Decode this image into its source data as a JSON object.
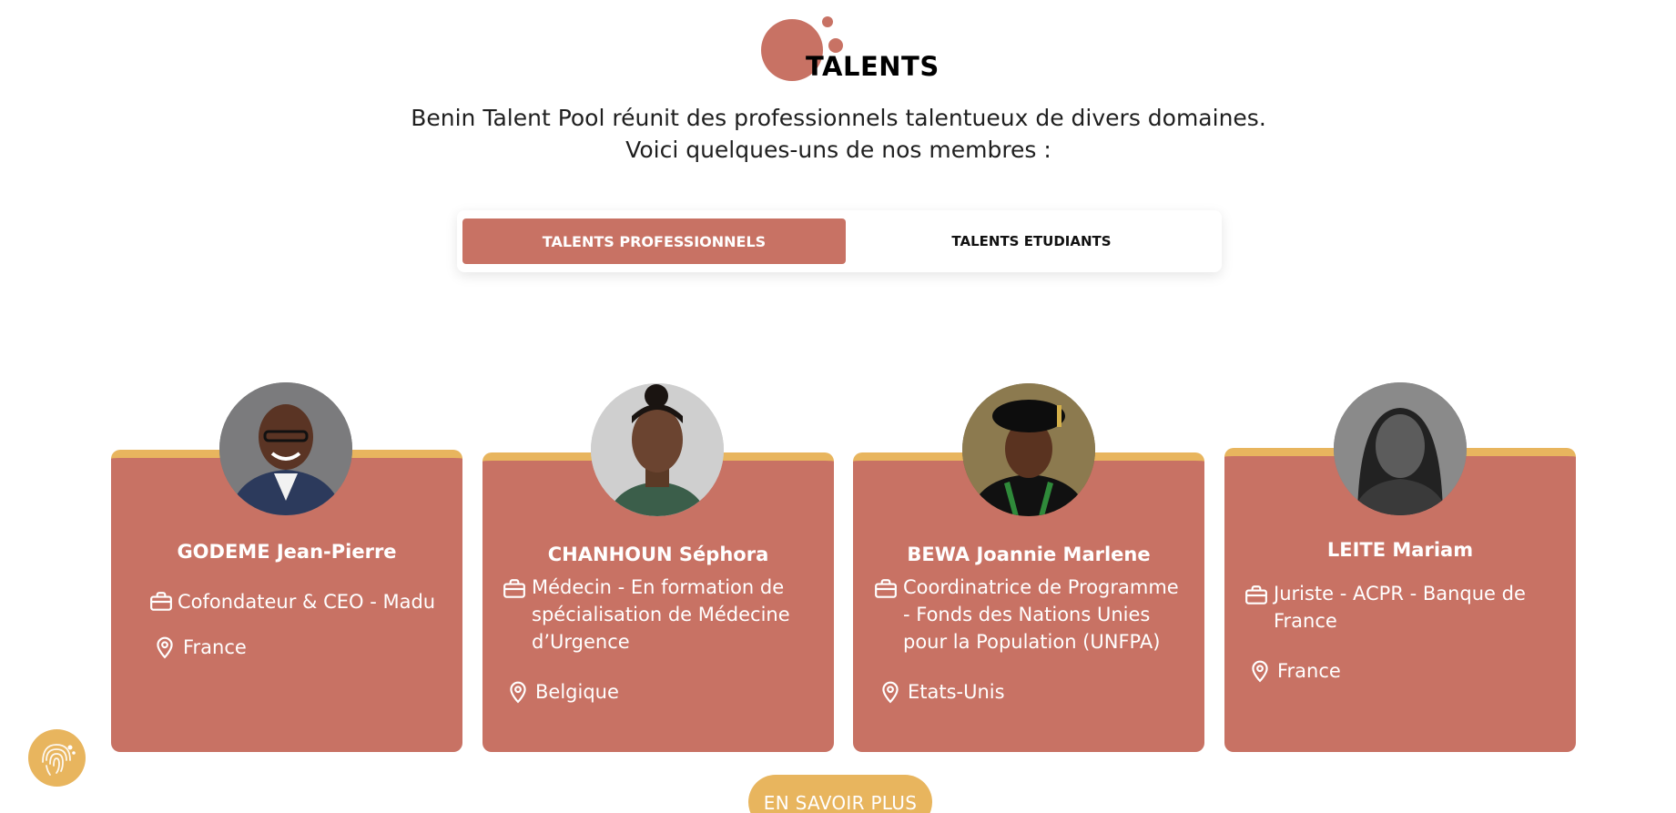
{
  "section": {
    "title": "TALENTS",
    "intro": "Benin Talent Pool réunit des professionnels talentueux de divers domaines. Voici quelques-uns de nos membres :"
  },
  "tabs": [
    {
      "label": "TALENTS PROFESSIONNELS",
      "active": true
    },
    {
      "label": "TALENTS ETUDIANTS",
      "active": false
    }
  ],
  "cards": [
    {
      "name": "GODEME Jean-Pierre",
      "role": "Cofondateur & CEO - Madu",
      "location": "France"
    },
    {
      "name": "CHANHOUN Séphora",
      "role": "Médecin - En formation de spécialisation de Médecine d’Urgence",
      "location": "Belgique"
    },
    {
      "name": "BEWA Joannie Marlene",
      "role": "Coordinatrice de Programme - Fonds des Nations Unies pour la Population (UNFPA)",
      "location": "Etats-Unis"
    },
    {
      "name": "LEITE Mariam",
      "role": "Juriste - ACPR - Banque de France",
      "location": "France"
    }
  ],
  "more_button": "EN SAVOIR PLUS",
  "colors": {
    "accent": "#c87264",
    "gold": "#e8b55e"
  },
  "icons": {
    "role": "briefcase-icon",
    "location": "map-pin-icon",
    "floating": "fingerprint-icon"
  }
}
